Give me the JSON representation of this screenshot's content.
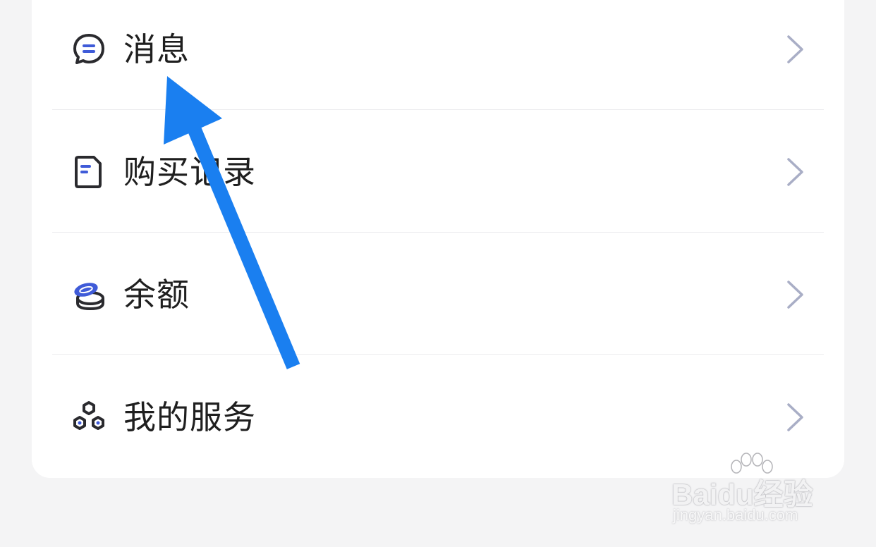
{
  "menu": {
    "items": [
      {
        "label": "消息",
        "icon": "message-bubble-icon"
      },
      {
        "label": "购买记录",
        "icon": "document-icon"
      },
      {
        "label": "余额",
        "icon": "coins-icon"
      },
      {
        "label": "我的服务",
        "icon": "services-icon"
      }
    ]
  },
  "watermark": {
    "brand": "Baidu经验",
    "url": "jingyan.baidu.com"
  },
  "colors": {
    "background": "#f4f4f5",
    "card": "#ffffff",
    "text": "#1f1f1f",
    "icon_dark": "#2a2a2e",
    "icon_accent": "#3f5bd8",
    "chevron": "#a9aec6",
    "annotation_arrow": "#1a7ff0"
  }
}
